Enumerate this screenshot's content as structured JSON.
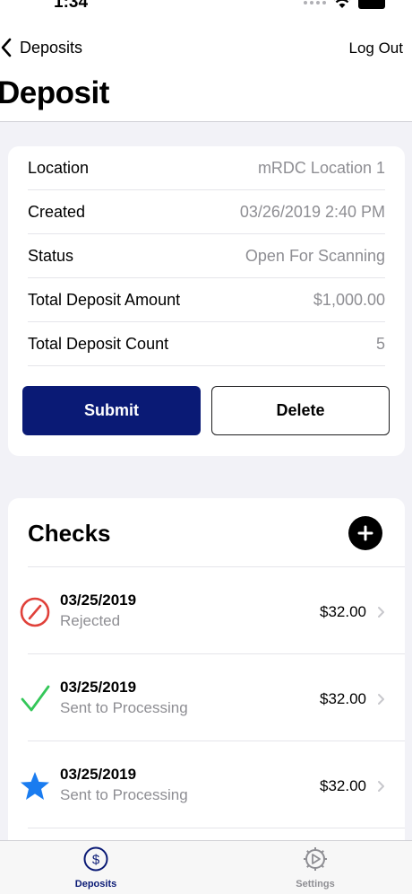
{
  "status_bar": {
    "time": "1:34"
  },
  "nav": {
    "back_label": "Deposits",
    "logout_label": "Log Out",
    "title": "Deposit"
  },
  "deposit_info": {
    "rows": [
      {
        "label": "Location",
        "value": "mRDC Location 1"
      },
      {
        "label": "Created",
        "value": "03/26/2019 2:40 PM"
      },
      {
        "label": "Status",
        "value": "Open For Scanning"
      },
      {
        "label": "Total Deposit Amount",
        "value": "$1,000.00"
      },
      {
        "label": "Total Deposit Count",
        "value": "5"
      }
    ],
    "submit_label": "Submit",
    "delete_label": "Delete"
  },
  "checks": {
    "title": "Checks",
    "items": [
      {
        "date": "03/25/2019",
        "status": "Rejected",
        "amount": "$32.00",
        "icon": "rejected-icon"
      },
      {
        "date": "03/25/2019",
        "status": "Sent to Processing",
        "amount": "$32.00",
        "icon": "checkmark-icon"
      },
      {
        "date": "03/25/2019",
        "status": "Sent to Processing",
        "amount": "$32.00",
        "icon": "star-icon"
      }
    ]
  },
  "tabs": {
    "deposits_label": "Deposits",
    "settings_label": "Settings"
  },
  "colors": {
    "accent": "#0a1a75",
    "rejected": "#e0413a",
    "success": "#34c759",
    "star": "#1a7cf0"
  }
}
